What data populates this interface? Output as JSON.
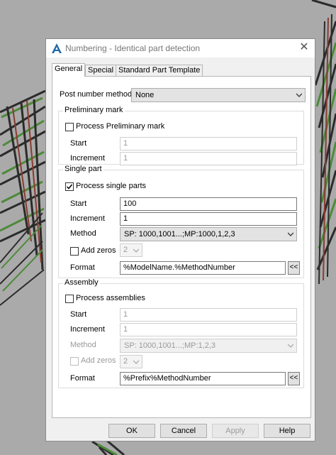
{
  "dialog": {
    "title": "Numbering - Identical part detection",
    "close_symbol": "✕"
  },
  "tabs": [
    {
      "label": "General",
      "active": true
    },
    {
      "label": "Special",
      "active": false
    },
    {
      "label": "Standard Part Template",
      "active": false
    }
  ],
  "post_number_method": {
    "label": "Post number method",
    "value": "None"
  },
  "preliminary_mark": {
    "legend": "Preliminary mark",
    "checkbox_label": "Process Preliminary mark",
    "checked": false,
    "start_label": "Start",
    "start_value": "1",
    "increment_label": "Increment",
    "increment_value": "1"
  },
  "single_part": {
    "legend": "Single part",
    "checkbox_label": "Process single parts",
    "checked": true,
    "start_label": "Start",
    "start_value": "100",
    "increment_label": "Increment",
    "increment_value": "1",
    "method_label": "Method",
    "method_value": "SP: 1000,1001...;MP:1000,1,2,3",
    "add_zeros_label": "Add zeros",
    "add_zeros_checked": false,
    "add_zeros_value": "2",
    "format_label": "Format",
    "format_value": "%ModelName.%MethodNumber",
    "format_button": "<<"
  },
  "assembly": {
    "legend": "Assembly",
    "checkbox_label": "Process assemblies",
    "checked": false,
    "start_label": "Start",
    "start_value": "1",
    "increment_label": "Increment",
    "increment_value": "1",
    "method_label": "Method",
    "method_value": "SP: 1000,1001...;MP:1,2,3",
    "add_zeros_label": "Add zeros",
    "add_zeros_checked": false,
    "add_zeros_value": "2",
    "format_label": "Format",
    "format_value": "%Prefix%MethodNumber",
    "format_button": "<<"
  },
  "buttons": {
    "ok": "OK",
    "cancel": "Cancel",
    "apply": "Apply",
    "help": "Help"
  },
  "colors": {
    "background": "#a9a9a9",
    "truss_dark": "#2b2b2b",
    "truss_green": "#4d8a3a",
    "truss_red": "#8a3b2f"
  }
}
